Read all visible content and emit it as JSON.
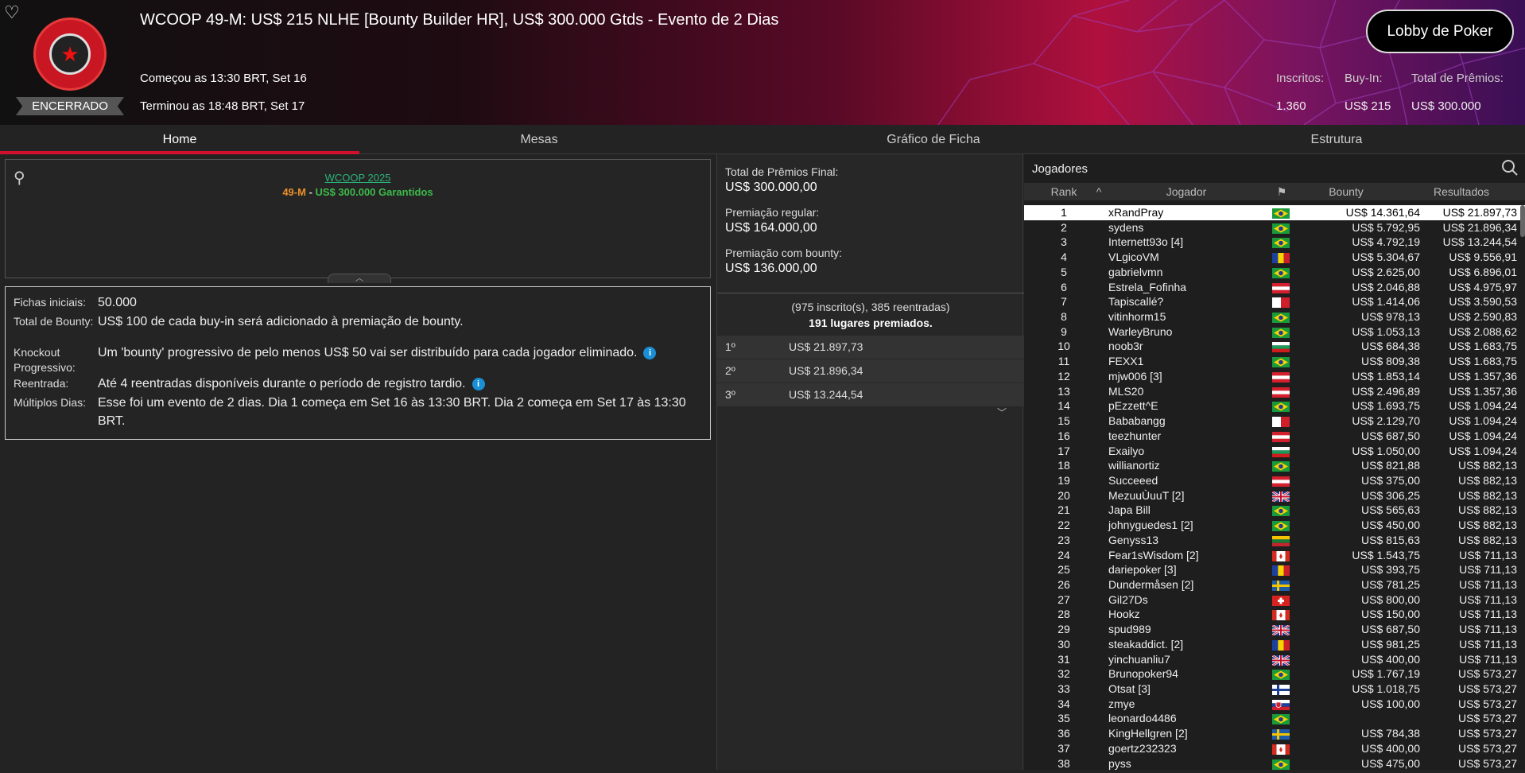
{
  "header": {
    "title": "WCOOP 49-M: US$ 215 NLHE [Bounty Builder HR], US$ 300.000 Gtds - Evento de 2 Dias",
    "status": "ENCERRADO",
    "started": "Começou as 13:30 BRT, Set 16",
    "ended": "Terminou as 18:48 BRT, Set 17",
    "lobby_button": "Lobby de Poker",
    "stats": {
      "entrants_label": "Inscritos:",
      "buyin_label": "Buy-In:",
      "prize_label": "Total de Prêmios:",
      "entrants": "1.360",
      "buyin": "US$ 215",
      "prize": "US$ 300.000"
    },
    "logo_icon": "wcoop-logo-icon",
    "favorite_icon": "heart-icon"
  },
  "tabs": [
    "Home",
    "Mesas",
    "Gráfico de Ficha",
    "Estrutura"
  ],
  "home": {
    "series_link": "WCOOP 2025",
    "event_code": "49-M",
    "separator": " - ",
    "guarantee": "US$ 300.000 Garantidos",
    "info": [
      {
        "key": "Fichas iniciais:",
        "value": "50.000"
      },
      {
        "key": "Total de Bounty:",
        "value": "US$ 100 de cada buy-in será adicionado à premiação de bounty."
      },
      {
        "key": "Knockout Progressivo:",
        "value": "Um 'bounty' progressivo de pelo menos US$ 50 vai ser distribuído para cada jogador eliminado."
      },
      {
        "key": "Reentrada:",
        "value": "Até 4 reentradas disponíveis durante o período de registro tardio."
      },
      {
        "key": "Múltiplos Dias:",
        "value": "Esse foi um evento de 2 dias. Dia 1 começa em Set 16 às 13:30 BRT. Dia 2 começa em Set 17 às 13:30 BRT."
      }
    ]
  },
  "prizes": {
    "final_label": "Total de Prêmios Final:",
    "final_value": "US$ 300.000,00",
    "regular_label": "Premiação regular:",
    "regular_value": "US$ 164.000,00",
    "bounty_label": "Premiação com bounty:",
    "bounty_value": "US$ 136.000,00",
    "entrants_text": "(975 inscrito(s), 385 reentradas)",
    "paid_text": "191 lugares premiados.",
    "places": [
      {
        "place": "1º",
        "amount": "US$ 21.897,73"
      },
      {
        "place": "2º",
        "amount": "US$ 21.896,34"
      },
      {
        "place": "3º",
        "amount": "US$ 13.244,54"
      }
    ]
  },
  "players": {
    "title": "Jogadores",
    "columns": {
      "rank": "Rank",
      "player": "Jogador",
      "bounty": "Bounty",
      "results": "Resultados"
    },
    "rows": [
      {
        "rank": "1",
        "name": "xRandPray",
        "flag": "br",
        "bounty": "US$ 14.361,64",
        "result": "US$ 21.897,73"
      },
      {
        "rank": "2",
        "name": "sydens",
        "flag": "br",
        "bounty": "US$ 5.792,95",
        "result": "US$ 21.896,34"
      },
      {
        "rank": "3",
        "name": "Internett93o [4]",
        "flag": "br",
        "bounty": "US$ 4.792,19",
        "result": "US$ 13.244,54"
      },
      {
        "rank": "4",
        "name": "VLgicoVM",
        "flag": "ro",
        "bounty": "US$ 5.304,67",
        "result": "US$ 9.556,91"
      },
      {
        "rank": "5",
        "name": "gabrielvmn",
        "flag": "br",
        "bounty": "US$ 2.625,00",
        "result": "US$ 6.896,01"
      },
      {
        "rank": "6",
        "name": "Estrela_Fofinha",
        "flag": "at",
        "bounty": "US$ 2.046,88",
        "result": "US$ 4.975,97"
      },
      {
        "rank": "7",
        "name": "Tapiscallé?",
        "flag": "mt",
        "bounty": "US$ 1.414,06",
        "result": "US$ 3.590,53"
      },
      {
        "rank": "8",
        "name": "vitinhorm15",
        "flag": "br",
        "bounty": "US$ 978,13",
        "result": "US$ 2.590,83"
      },
      {
        "rank": "9",
        "name": "WarleyBruno",
        "flag": "br",
        "bounty": "US$ 1.053,13",
        "result": "US$ 2.088,62"
      },
      {
        "rank": "10",
        "name": "noob3r",
        "flag": "bg",
        "bounty": "US$ 684,38",
        "result": "US$ 1.683,75"
      },
      {
        "rank": "11",
        "name": "FEXX1",
        "flag": "br",
        "bounty": "US$ 809,38",
        "result": "US$ 1.683,75"
      },
      {
        "rank": "12",
        "name": "mjw006 [3]",
        "flag": "at",
        "bounty": "US$ 1.853,14",
        "result": "US$ 1.357,36"
      },
      {
        "rank": "13",
        "name": "MLS20",
        "flag": "at",
        "bounty": "US$ 2.496,89",
        "result": "US$ 1.357,36"
      },
      {
        "rank": "14",
        "name": "pEzzett^E",
        "flag": "br",
        "bounty": "US$ 1.693,75",
        "result": "US$ 1.094,24"
      },
      {
        "rank": "15",
        "name": "Bababangg",
        "flag": "mt",
        "bounty": "US$ 2.129,70",
        "result": "US$ 1.094,24"
      },
      {
        "rank": "16",
        "name": "teezhunter",
        "flag": "at",
        "bounty": "US$ 687,50",
        "result": "US$ 1.094,24"
      },
      {
        "rank": "17",
        "name": "Exailyo",
        "flag": "bg",
        "bounty": "US$ 1.050,00",
        "result": "US$ 1.094,24"
      },
      {
        "rank": "18",
        "name": "willianortiz",
        "flag": "br",
        "bounty": "US$ 821,88",
        "result": "US$ 882,13"
      },
      {
        "rank": "19",
        "name": "Succeeed",
        "flag": "at",
        "bounty": "US$ 375,00",
        "result": "US$ 882,13"
      },
      {
        "rank": "20",
        "name": "MezuuÙuuT [2]",
        "flag": "gb",
        "bounty": "US$ 306,25",
        "result": "US$ 882,13"
      },
      {
        "rank": "21",
        "name": "Japa Bill",
        "flag": "br",
        "bounty": "US$ 565,63",
        "result": "US$ 882,13"
      },
      {
        "rank": "22",
        "name": "johnyguedes1 [2]",
        "flag": "br",
        "bounty": "US$ 450,00",
        "result": "US$ 882,13"
      },
      {
        "rank": "23",
        "name": "Genyss13",
        "flag": "lt",
        "bounty": "US$ 815,63",
        "result": "US$ 882,13"
      },
      {
        "rank": "24",
        "name": "Fear1sWisdom [2]",
        "flag": "ca",
        "bounty": "US$ 1.543,75",
        "result": "US$ 711,13"
      },
      {
        "rank": "25",
        "name": "dariepoker [3]",
        "flag": "ro",
        "bounty": "US$ 393,75",
        "result": "US$ 711,13"
      },
      {
        "rank": "26",
        "name": "Dundermåsen [2]",
        "flag": "se",
        "bounty": "US$ 781,25",
        "result": "US$ 711,13"
      },
      {
        "rank": "27",
        "name": "Gil27Ds",
        "flag": "ch",
        "bounty": "US$ 800,00",
        "result": "US$ 711,13"
      },
      {
        "rank": "28",
        "name": "Hookz",
        "flag": "ca",
        "bounty": "US$ 150,00",
        "result": "US$ 711,13"
      },
      {
        "rank": "29",
        "name": "spud989",
        "flag": "gb",
        "bounty": "US$ 687,50",
        "result": "US$ 711,13"
      },
      {
        "rank": "30",
        "name": "steakaddict. [2]",
        "flag": "ro",
        "bounty": "US$ 981,25",
        "result": "US$ 711,13"
      },
      {
        "rank": "31",
        "name": "yinchuanliu7",
        "flag": "gb",
        "bounty": "US$ 400,00",
        "result": "US$ 711,13"
      },
      {
        "rank": "32",
        "name": "Brunopoker94",
        "flag": "br",
        "bounty": "US$ 1.767,19",
        "result": "US$ 573,27"
      },
      {
        "rank": "33",
        "name": "Otsat [3]",
        "flag": "fi",
        "bounty": "US$ 1.018,75",
        "result": "US$ 573,27"
      },
      {
        "rank": "34",
        "name": "zmye",
        "flag": "sk",
        "bounty": "US$ 100,00",
        "result": "US$ 573,27"
      },
      {
        "rank": "35",
        "name": "leonardo4486",
        "flag": "br",
        "bounty": "",
        "result": "US$ 573,27"
      },
      {
        "rank": "36",
        "name": "KingHellgren [2]",
        "flag": "se",
        "bounty": "US$ 784,38",
        "result": "US$ 573,27"
      },
      {
        "rank": "37",
        "name": "goertz232323",
        "flag": "ca",
        "bounty": "US$ 400,00",
        "result": "US$ 573,27"
      },
      {
        "rank": "38",
        "name": "pyss",
        "flag": "br",
        "bounty": "US$ 475,00",
        "result": "US$ 573,27"
      }
    ]
  }
}
